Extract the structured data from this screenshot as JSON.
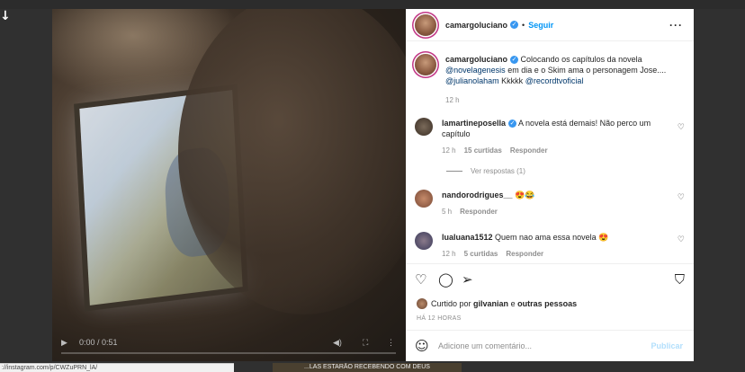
{
  "post": {
    "username": "camargoluciano",
    "follow_label": "Seguir",
    "caption_prefix": "Colocando os capítulos da novela ",
    "caption_mention1": "@novelagenesis",
    "caption_mid": " em dia e o Skim ama o personagem Jose.... ",
    "caption_mention2": "@julianolaham",
    "caption_kkk": " Kkkkk ",
    "caption_mention3": "@recordtvoficial",
    "caption_time": "12 h"
  },
  "video": {
    "time": "0:00 / 0:51"
  },
  "comments": [
    {
      "user": "lamartineposella",
      "text": "A novela está demais! Não perco um capítulo",
      "time": "12 h",
      "likes": "15 curtidas",
      "reply": "Responder",
      "verified": true
    },
    {
      "user": "nandorodrigues__",
      "text": "😍😂",
      "time": "5 h",
      "likes": "",
      "reply": "Responder",
      "verified": false
    },
    {
      "user": "lualuana1512",
      "text": "Quem nao ama essa novela 😍",
      "time": "12 h",
      "likes": "5 curtidas",
      "reply": "Responder",
      "verified": false
    }
  ],
  "view_replies": "Ver respostas (1)",
  "liked_by": {
    "prefix": "Curtido por ",
    "user": "gilvanian",
    "mid": " e ",
    "others": "outras pessoas"
  },
  "posted_ago": "HÁ 12 HORAS",
  "add_comment": {
    "placeholder": "Adicione um comentário...",
    "publish": "Publicar"
  },
  "status_url": "://instagram.com/p/CWZuPRN_lA/",
  "bottom_banner": "...LAS ESTARÃO RECEBENDO COM DEUS"
}
